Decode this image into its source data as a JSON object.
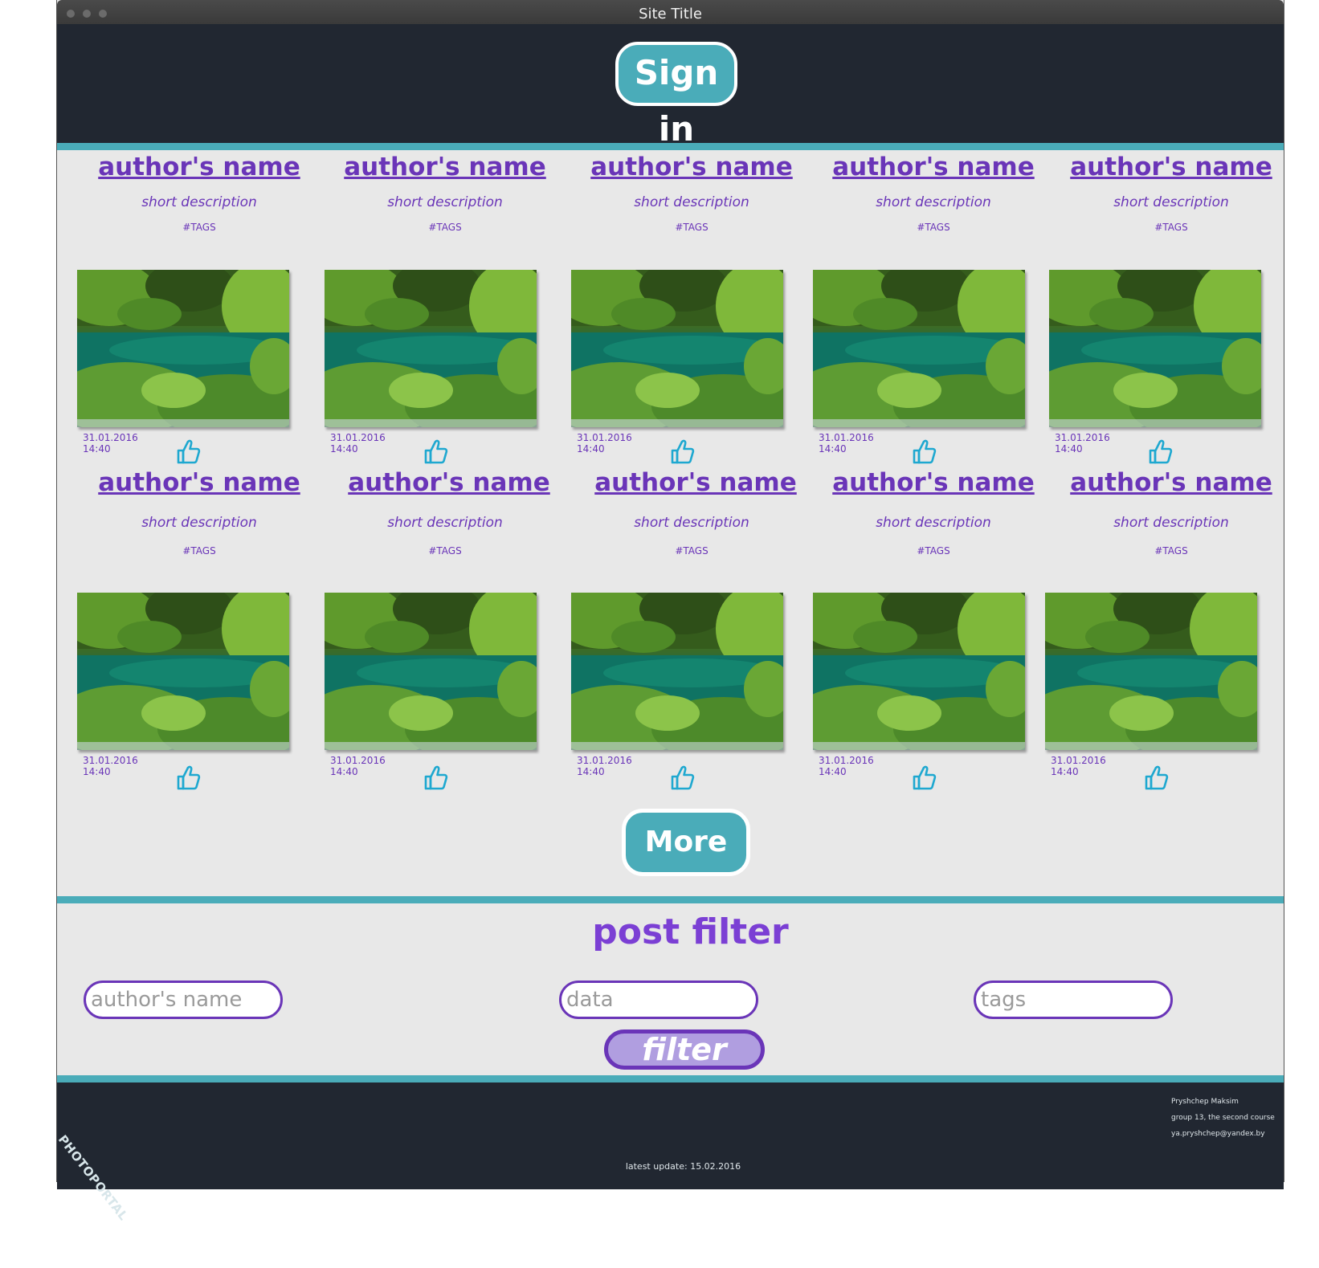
{
  "window": {
    "title": "Site Title"
  },
  "header": {
    "signin_label": "Sign in"
  },
  "posts": [
    {
      "author": "author's name",
      "description": "short description",
      "tags": "#TAGS",
      "date": "31.01.2016",
      "time": "14:40"
    },
    {
      "author": "author's name",
      "description": "short description",
      "tags": "#TAGS",
      "date": "31.01.2016",
      "time": "14:40"
    },
    {
      "author": "author's name",
      "description": "short description",
      "tags": "#TAGS",
      "date": "31.01.2016",
      "time": "14:40"
    },
    {
      "author": "author's name",
      "description": "short description",
      "tags": "#TAGS",
      "date": "31.01.2016",
      "time": "14:40"
    },
    {
      "author": "author's name",
      "description": "short description",
      "tags": "#TAGS",
      "date": "31.01.2016",
      "time": "14:40"
    },
    {
      "author": "author's name",
      "description": "short description",
      "tags": "#TAGS",
      "date": "31.01.2016",
      "time": "14:40"
    },
    {
      "author": "author's name",
      "description": "short description",
      "tags": "#TAGS",
      "date": "31.01.2016",
      "time": "14:40"
    },
    {
      "author": "author's name",
      "description": "short description",
      "tags": "#TAGS",
      "date": "31.01.2016",
      "time": "14:40"
    },
    {
      "author": "author's name",
      "description": "short description",
      "tags": "#TAGS",
      "date": "31.01.2016",
      "time": "14:40"
    },
    {
      "author": "author's name",
      "description": "short description",
      "tags": "#TAGS",
      "date": "31.01.2016",
      "time": "14:40"
    }
  ],
  "more_label": "More",
  "filter": {
    "title": "post filter",
    "author_placeholder": "author's name",
    "data_placeholder": "data",
    "tags_placeholder": "tags",
    "button_label": "filter"
  },
  "footer": {
    "logo": "PHOTOPORTAL",
    "latest_update": "latest update: 15.02.2016",
    "contact_name": "Pryshchep Maksim",
    "contact_group": "group 13, the second course",
    "contact_email": "ya.pryshchep@yandex.by"
  },
  "colors": {
    "accent_teal": "#4aacb9",
    "text_purple": "#6a35b8",
    "dark_bg": "#212731",
    "like_icon": "#1ea8d0"
  },
  "icons": {
    "like": "thumbs-up-icon"
  }
}
